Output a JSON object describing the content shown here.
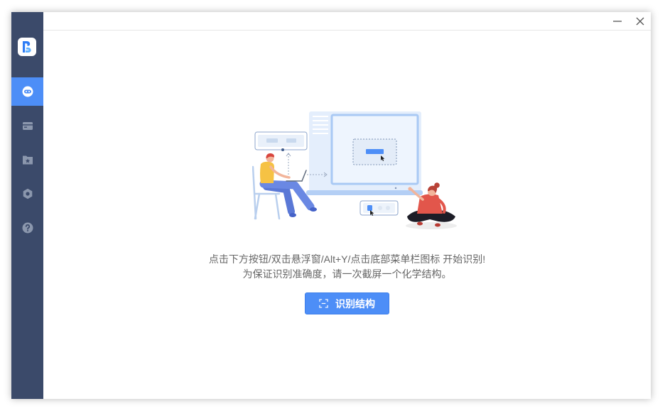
{
  "window": {
    "controls": {
      "minimize_icon": "minimize-icon",
      "close_icon": "close-icon"
    }
  },
  "sidebar": {
    "logo_icon": "app-logo-icon",
    "items": [
      {
        "icon": "robot-face-icon",
        "active": true
      },
      {
        "icon": "card-icon",
        "active": false
      },
      {
        "icon": "folder-star-icon",
        "active": false
      },
      {
        "icon": "hexagon-settings-icon",
        "active": false
      },
      {
        "icon": "help-icon",
        "active": false
      }
    ]
  },
  "main": {
    "instruction_line1": "点击下方按钮/双击悬浮窗/Alt+Y/点击底部菜单栏图标 开始识别!",
    "instruction_line2": "为保证识别准确度，请一次截屏一个化学结构。",
    "recognize_button": {
      "icon": "scan-icon",
      "label": "识别结构"
    }
  },
  "colors": {
    "sidebar_bg": "#3b4a6a",
    "sidebar_icon": "#8b97ad",
    "accent": "#4d8ef7",
    "body_text": "#666666"
  }
}
